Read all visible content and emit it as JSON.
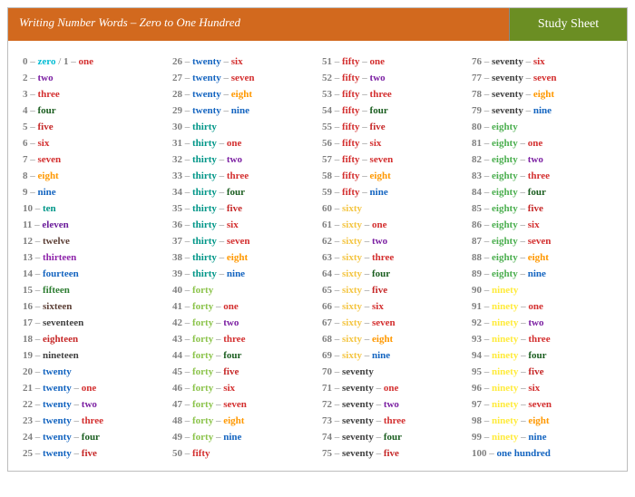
{
  "header": {
    "title": "Writing Number Words – Zero to One Hundred",
    "badge": "Study Sheet"
  },
  "colors": {
    "zero": {
      "color": "#00bcd4",
      "word": "zero"
    },
    "one": {
      "color": "#d32f2f",
      "word": "one"
    },
    "two": {
      "color": "#7b1fa2",
      "word": "two"
    },
    "three": {
      "color": "#d32f2f",
      "word": "three"
    },
    "four": {
      "color": "#1b5e20",
      "word": "four"
    },
    "five": {
      "color": "#c62828",
      "word": "five"
    },
    "six": {
      "color": "#d32f2f",
      "word": "six"
    },
    "seven": {
      "color": "#d32f2f",
      "word": "seven"
    },
    "eight": {
      "color": "#ff9800",
      "word": "eight"
    },
    "nine": {
      "color": "#1565c0",
      "word": "nine"
    },
    "ten": {
      "color": "#009688",
      "word": "ten"
    },
    "eleven": {
      "color": "#6a1b9a",
      "word": "eleven"
    },
    "twelve": {
      "color": "#5d4037",
      "word": "twelve"
    },
    "thirteen": {
      "color": "#8e24aa",
      "word": "thirteen"
    },
    "fourteen": {
      "color": "#1565c0",
      "word": "fourteen"
    },
    "fifteen": {
      "color": "#2e7d32",
      "word": "fifteen"
    },
    "sixteen": {
      "color": "#5d4037",
      "word": "sixteen"
    },
    "seventeen": {
      "color": "#424242",
      "word": "seventeen"
    },
    "eighteen": {
      "color": "#c62828",
      "word": "eighteen"
    },
    "nineteen": {
      "color": "#424242",
      "word": "nineteen"
    },
    "twenty": {
      "color": "#1565c0",
      "word": "twenty"
    },
    "thirty": {
      "color": "#009688",
      "word": "thirty"
    },
    "forty": {
      "color": "#8bc34a",
      "word": "forty"
    },
    "fifty": {
      "color": "#d32f2f",
      "word": "fifty"
    },
    "sixty": {
      "color": "#f4c542",
      "word": "sixty"
    },
    "seventy": {
      "color": "#424242",
      "word": "seventy"
    },
    "eighty": {
      "color": "#4caf50",
      "word": "eighty"
    },
    "ninety": {
      "color": "#ffeb3b",
      "word": "ninety"
    },
    "hundred": {
      "color": "#1565c0",
      "word": "one hundred"
    }
  },
  "layout": {
    "columns": [
      {
        "start": 0,
        "end": 25
      },
      {
        "start": 26,
        "end": 50
      },
      {
        "start": 51,
        "end": 75
      },
      {
        "start": 76,
        "end": 100
      }
    ]
  }
}
